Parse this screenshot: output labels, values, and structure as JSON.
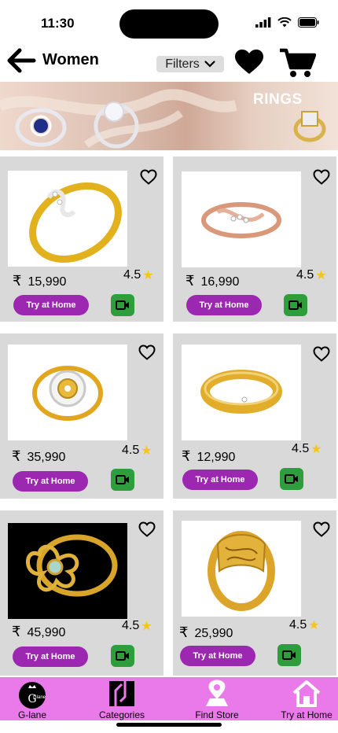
{
  "status": {
    "time": "11:30"
  },
  "header": {
    "title": "Women",
    "filters_label": "Filters"
  },
  "banner": {
    "label": "RINGS"
  },
  "products": [
    {
      "price": "15,990",
      "rating": "4.5",
      "try_label": "Try at Home"
    },
    {
      "price": "16,990",
      "rating": "4.5",
      "try_label": "Try at Home"
    },
    {
      "price": "35,990",
      "rating": "4.5",
      "try_label": "Try at Home"
    },
    {
      "price": "12,990",
      "rating": "4.5",
      "try_label": "Try at Home"
    },
    {
      "price": "45,990",
      "rating": "4.5",
      "try_label": "Try at Home"
    },
    {
      "price": "25,990",
      "rating": "4.5",
      "try_label": "Try at Home"
    }
  ],
  "currency_symbol": "₹",
  "bottom_nav": {
    "logo_text": "Glane",
    "items": [
      {
        "label": "G-lane",
        "icon": "logo-icon"
      },
      {
        "label": "Categories",
        "icon": "categories-icon"
      },
      {
        "label": "Find Store",
        "icon": "location-pin-icon"
      },
      {
        "label": "Try at Home",
        "icon": "home-icon"
      }
    ]
  },
  "colors": {
    "accent_purple": "#9c27b0",
    "video_green": "#2e9e3d",
    "nav_pink": "#ea7aea",
    "card_gray": "#d9d9d9",
    "star": "#f5c518"
  }
}
